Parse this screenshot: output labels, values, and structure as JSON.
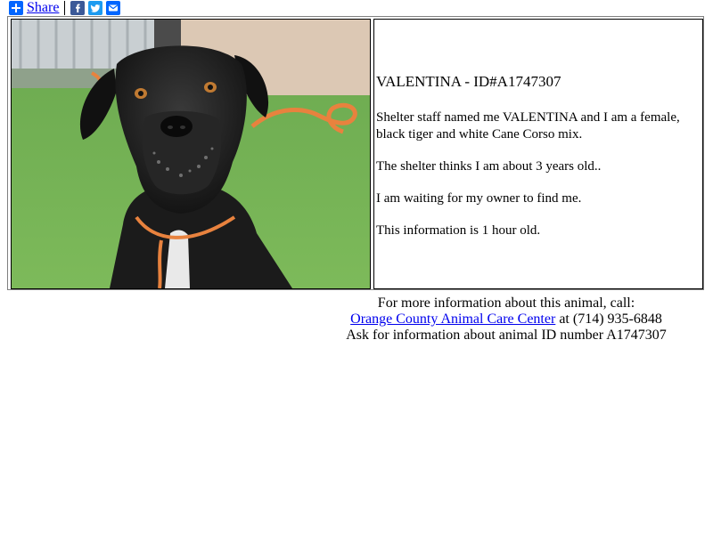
{
  "share": {
    "label": "Share",
    "icons": [
      "share-plus-icon",
      "facebook-icon",
      "twitter-icon",
      "email-icon"
    ]
  },
  "animal": {
    "title": "VALENTINA - ID#A1747307",
    "description": "Shelter staff named me VALENTINA and I am a female, black tiger and white Cane Corso mix.",
    "age": "The shelter thinks I am about 3 years old..",
    "status": "I am waiting for my owner to find me.",
    "freshness": "This information is 1 hour old."
  },
  "contact": {
    "intro": "For more information about this animal, call:",
    "shelter_link": "Orange County Animal Care Center",
    "phone": "at (714) 935-6848",
    "ask": "Ask for information about animal ID number A1747307"
  }
}
